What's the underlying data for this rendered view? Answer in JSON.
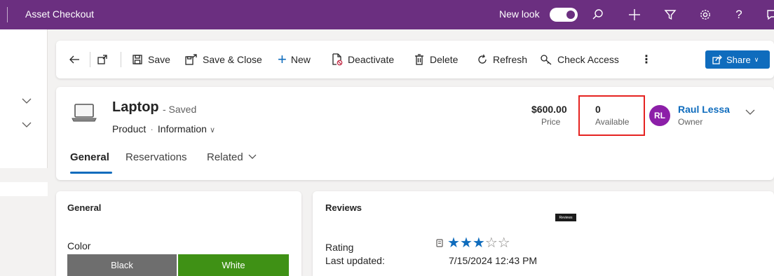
{
  "topbar": {
    "app_title": "Asset Checkout",
    "new_look_label": "New look",
    "new_look_on": true,
    "icons": [
      "search-icon",
      "plus-icon",
      "filter-icon",
      "settings-icon",
      "help-icon",
      "copilot-icon"
    ]
  },
  "commands": {
    "save": "Save",
    "save_close": "Save & Close",
    "new": "New",
    "deactivate": "Deactivate",
    "delete": "Delete",
    "refresh": "Refresh",
    "check_access": "Check Access",
    "more": "⋮",
    "share": "Share"
  },
  "record": {
    "title": "Laptop",
    "status": "- Saved",
    "entity": "Product",
    "form": "Information",
    "price_value": "$600.00",
    "price_label": "Price",
    "available_value": "0",
    "available_label": "Available",
    "owner_initials": "RL",
    "owner_name": "Raul Lessa",
    "owner_label": "Owner"
  },
  "tabs": [
    "General",
    "Reservations",
    "Related"
  ],
  "general_section": {
    "title": "General",
    "color_label": "Color",
    "color_options": [
      "Black",
      "White"
    ],
    "color_selected": "White"
  },
  "reviews_section": {
    "title": "Reviews",
    "tooltip": "Reviews",
    "rating_label": "Rating",
    "rating_value": 3,
    "rating_max": 5,
    "last_updated_label": "Last updated:",
    "last_updated_value": "7/15/2024 12:43 PM"
  },
  "colors": {
    "topbar": "#6b2f80",
    "accent": "#0f6cbd",
    "highlight_box": "#e52321",
    "avatar": "#8c1fa8",
    "option_black": "#6e6e6e",
    "option_white": "#3f9115"
  }
}
